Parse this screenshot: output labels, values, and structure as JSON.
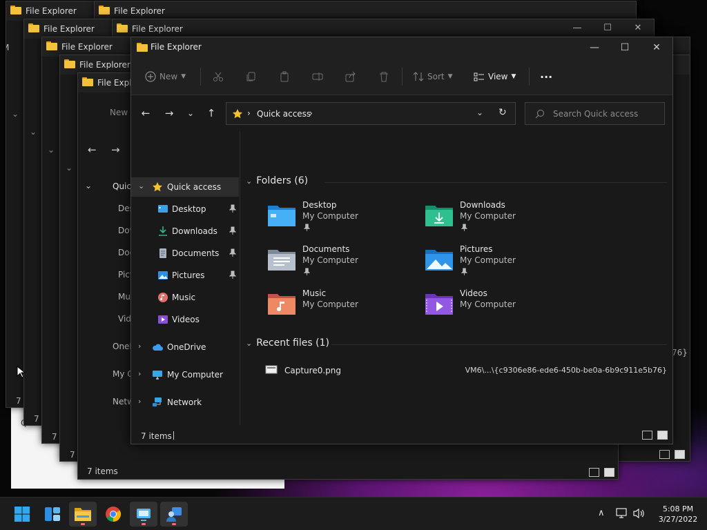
{
  "window_title": "File Explorer",
  "background_windows": {
    "status_text_a": "7 items",
    "status_text_b": "7 items",
    "fragments": {
      "new": "New",
      "quick": "Quic",
      "desktop": "Des",
      "downloads": "Dov",
      "documents": "Doc",
      "pictures": "Pict",
      "music": "Mu",
      "videos": "Vid",
      "onedrive": "OneD",
      "mycomputer": "My C",
      "network": "Netw",
      "path_tail": "76}",
      "left_m": "M",
      "seven_i_1": "7 i",
      "seven_i_2": "7 i",
      "seven_i_3": "7 i",
      "seven_i_4": "7 i"
    }
  },
  "command_bar": {
    "new": "New",
    "sort": "Sort",
    "view": "View",
    "more": "···"
  },
  "address": {
    "breadcrumb": "Quick access",
    "search_placeholder": "Search Quick access"
  },
  "nav": {
    "quick_access": "Quick access",
    "desktop": "Desktop",
    "downloads": "Downloads",
    "documents": "Documents",
    "pictures": "Pictures",
    "music": "Music",
    "videos": "Videos",
    "onedrive": "OneDrive",
    "my_computer": "My Computer",
    "network": "Network"
  },
  "content": {
    "folders_header": "Folders (6)",
    "folders": [
      {
        "name": "Desktop",
        "location": "My Computer"
      },
      {
        "name": "Downloads",
        "location": "My Computer"
      },
      {
        "name": "Documents",
        "location": "My Computer"
      },
      {
        "name": "Pictures",
        "location": "My Computer"
      },
      {
        "name": "Music",
        "location": "My Computer"
      },
      {
        "name": "Videos",
        "location": "My Computer"
      }
    ],
    "recent_header": "Recent files (1)",
    "recent_files": [
      {
        "name": "Capture0.png",
        "path": "VM6\\...\\{c9306e86-ede6-450b-be0a-6b9c911e5b76}"
      }
    ]
  },
  "status": {
    "item_count": "7 items"
  },
  "taskbar": {
    "time": "5:08 PM",
    "date": "3/27/2022"
  },
  "colors": {
    "accent_folder": "#f4c23a",
    "taskbar_indicator": "#ff6b6b",
    "selection": "#2d2d2d"
  }
}
